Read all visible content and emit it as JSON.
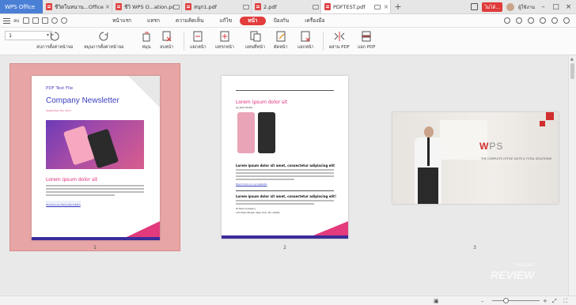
{
  "tabs": {
    "home": "WPS Office",
    "items": [
      {
        "label": "ชีวิตในหนาน...Office.pdf"
      },
      {
        "label": "ชีวิ WPS O...ation.pdf"
      },
      {
        "label": "สนุก1.pdf"
      },
      {
        "label": "2.pdf"
      },
      {
        "label": "PDFTEST.pdf"
      }
    ],
    "add": "+",
    "lang_badge": "ไม่ได้...",
    "user": "ผู้ใช้งาน"
  },
  "menu": {
    "short": "ลบ",
    "items": [
      "หน้าแรก",
      "แทรก",
      "ความคิดเห็น",
      "แก้ไข",
      "หน้า",
      "ป้องกัน",
      "เครื่องมือ"
    ],
    "active_index": 4
  },
  "toolbar": {
    "page_value": "1",
    "tools": [
      {
        "label": "ลบการตั้งค่าหน้าจอ"
      },
      {
        "label": "หมุนการตั้งค่าหน้าจอ"
      },
      {
        "label": "หมุน"
      },
      {
        "label": "ลบหน้า"
      },
      {
        "label": "แยกหน้า"
      },
      {
        "label": "แทรกหน้า"
      },
      {
        "label": "แทนที่หน้า"
      },
      {
        "label": "ตัดหน้า"
      },
      {
        "label": "แยกหน้า"
      },
      {
        "label": "ผสาน PDF"
      },
      {
        "label": "แยก PDF"
      }
    ]
  },
  "pages": {
    "p1": {
      "header": "PDF Test File",
      "title": "Company Newsletter",
      "date": "September 5th, 2017",
      "subtitle": "Lorem ipsum dolor sit",
      "button": "Produce our favourite button",
      "number": "1"
    },
    "p2": {
      "title": "Lorem ipsum dolor sit",
      "byline": "by Jade Parker",
      "bold": "Lorem ipsum dolor sit amet, consectetur adipiscing elit",
      "link": "Read more on our website",
      "bold2": "Lorem ipsum dolor sit amet, consectetur adipiscing elit!",
      "addr1": "W Test Company",
      "addr2": "123 Fake Street, New York, NY 10001",
      "number": "2"
    },
    "p3": {
      "logo_w": "W",
      "logo_rest": "PS",
      "slogan": "THE COMPLETE OFFICE SUITE & TOTAL SOLUTIONS",
      "number": "3"
    }
  },
  "watermark": {
    "brand": "REVIEW",
    "small": "THAIWARE"
  },
  "colors": {
    "accent": "#e33d3d",
    "tab_home": "#4a7fd6",
    "selection": "#e7a5a5"
  }
}
